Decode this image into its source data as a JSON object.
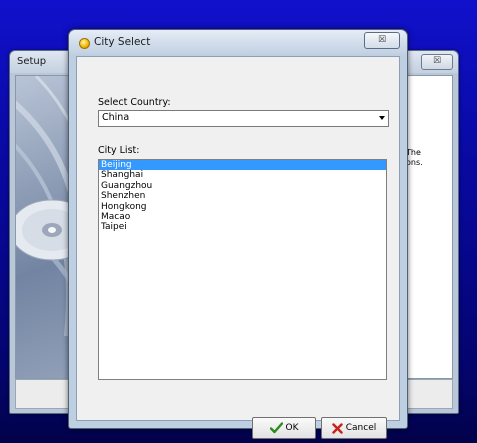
{
  "background_window": {
    "title": "Setup",
    "close_glyph": "☒",
    "text_lines": [
      "The",
      "ons."
    ]
  },
  "dialog": {
    "title": "City Select",
    "close_glyph": "☒",
    "country_label": "Select Country:",
    "country_value": "China",
    "city_list_label": "City List:",
    "cities": [
      "Beijing",
      "Shanghai",
      "Guangzhou",
      "Shenzhen",
      "Hongkong",
      "Macao",
      "Taipei"
    ],
    "selected_city": "Beijing",
    "ok_label": "OK",
    "cancel_label": "Cancel"
  },
  "colors": {
    "selection": "#3399ff",
    "ok_check": "#2d8a1f",
    "cancel_x": "#c8201a"
  },
  "icons": {
    "app": "app-icon",
    "ok": "checkmark-icon",
    "cancel": "x-icon"
  }
}
